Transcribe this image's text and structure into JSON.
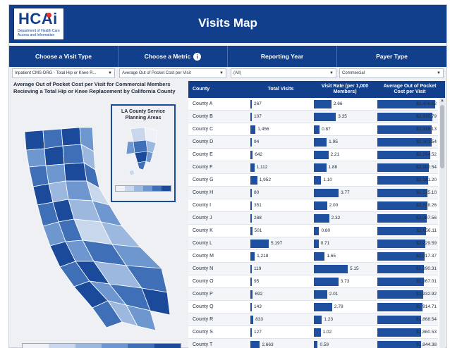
{
  "header": {
    "logo_text": "HCAi",
    "logo_subtitle": "Department of Health Care Access and Information",
    "title": "Visits Map"
  },
  "filters": {
    "labels": [
      "Choose a Visit Type",
      "Choose a Metric",
      "Reporting Year",
      "Payer Type"
    ],
    "visit_type_value": "Inpatient CMS-DRG - Total Hip or Knee R...",
    "metric_value": "Average Out of Pocket Cost per Visit",
    "year_value": "(All)",
    "payer_value": "Commercial"
  },
  "map": {
    "title": "Average Out of Pocket Cost per Visit for Commercial Members Recieving a Total Hip or Knee Replacement by California County",
    "la_inset_title": "LA County Service Planning Areas",
    "legend_colors": [
      "#eef2f8",
      "#c9d7ec",
      "#9db8df",
      "#6f97cf",
      "#3f6fb7",
      "#1b4a9a"
    ]
  },
  "table": {
    "columns": [
      "County",
      "Total Visits",
      "Visit Rate (per 1,000 Members)",
      "Average Out of Pocket Cost per Visit"
    ],
    "rows": [
      {
        "county": "County A",
        "visits": "267",
        "visits_n": 267,
        "rate": "2.66",
        "rate_n": 2.66,
        "cost": "$2,456.82",
        "cost_n": 2456.82
      },
      {
        "county": "County B",
        "visits": "107",
        "visits_n": 107,
        "rate": "3.35",
        "rate_n": 3.35,
        "cost": "$2,335.79",
        "cost_n": 2335.79
      },
      {
        "county": "County C",
        "visits": "1,456",
        "visits_n": 1456,
        "rate": "0.87",
        "rate_n": 0.87,
        "cost": "$2,318.13",
        "cost_n": 2318.13
      },
      {
        "county": "County D",
        "visits": "94",
        "visits_n": 94,
        "rate": "1.95",
        "rate_n": 1.95,
        "cost": "$2,301.54",
        "cost_n": 2301.54
      },
      {
        "county": "County E",
        "visits": "642",
        "visits_n": 642,
        "rate": "2.21",
        "rate_n": 2.21,
        "cost": "$2,254.52",
        "cost_n": 2254.52
      },
      {
        "county": "County F",
        "visits": "1,112",
        "visits_n": 1112,
        "rate": "1.88",
        "rate_n": 1.88,
        "cost": "$2,192.54",
        "cost_n": 2192.54
      },
      {
        "county": "County G",
        "visits": "1,952",
        "visits_n": 1952,
        "rate": "1.10",
        "rate_n": 1.1,
        "cost": "$2,161.20",
        "cost_n": 2161.2
      },
      {
        "county": "County H",
        "visits": "80",
        "visits_n": 80,
        "rate": "3.77",
        "rate_n": 3.77,
        "cost": "$2,135.10",
        "cost_n": 2135.1
      },
      {
        "county": "County I",
        "visits": "351",
        "visits_n": 351,
        "rate": "2.00",
        "rate_n": 2.0,
        "cost": "$2,128.26",
        "cost_n": 2128.26
      },
      {
        "county": "County J",
        "visits": "288",
        "visits_n": 288,
        "rate": "2.32",
        "rate_n": 2.32,
        "cost": "$2,087.56",
        "cost_n": 2087.56
      },
      {
        "county": "County K",
        "visits": "501",
        "visits_n": 501,
        "rate": "0.80",
        "rate_n": 0.8,
        "cost": "$2,056.11",
        "cost_n": 2056.11
      },
      {
        "county": "County L",
        "visits": "5,197",
        "visits_n": 5197,
        "rate": "0.71",
        "rate_n": 0.71,
        "cost": "$2,029.59",
        "cost_n": 2029.59
      },
      {
        "county": "County M",
        "visits": "1,218",
        "visits_n": 1218,
        "rate": "1.65",
        "rate_n": 1.65,
        "cost": "$2,017.37",
        "cost_n": 2017.37
      },
      {
        "county": "County N",
        "visits": "119",
        "visits_n": 119,
        "rate": "5.15",
        "rate_n": 5.15,
        "cost": "$1,990.31",
        "cost_n": 1990.31
      },
      {
        "county": "County O",
        "visits": "95",
        "visits_n": 95,
        "rate": "3.73",
        "rate_n": 3.73,
        "cost": "$1,967.01",
        "cost_n": 1967.01
      },
      {
        "county": "County P",
        "visits": "692",
        "visits_n": 692,
        "rate": "2.01",
        "rate_n": 2.01,
        "cost": "$1,932.92",
        "cost_n": 1932.92
      },
      {
        "county": "County Q",
        "visits": "143",
        "visits_n": 143,
        "rate": "2.78",
        "rate_n": 2.78,
        "cost": "$1,914.71",
        "cost_n": 1914.71
      },
      {
        "county": "County R",
        "visits": "833",
        "visits_n": 833,
        "rate": "1.23",
        "rate_n": 1.23,
        "cost": "$1,868.54",
        "cost_n": 1868.54
      },
      {
        "county": "County S",
        "visits": "127",
        "visits_n": 127,
        "rate": "1.02",
        "rate_n": 1.02,
        "cost": "$1,860.53",
        "cost_n": 1860.53
      },
      {
        "county": "County T",
        "visits": "2,663",
        "visits_n": 2663,
        "rate": "0.59",
        "rate_n": 0.59,
        "cost": "$1,844.38",
        "cost_n": 1844.38
      }
    ]
  },
  "colors": {
    "brand": "#123f8c",
    "bar": "#1f4f9f",
    "panel_bg": "#eef0f4"
  }
}
